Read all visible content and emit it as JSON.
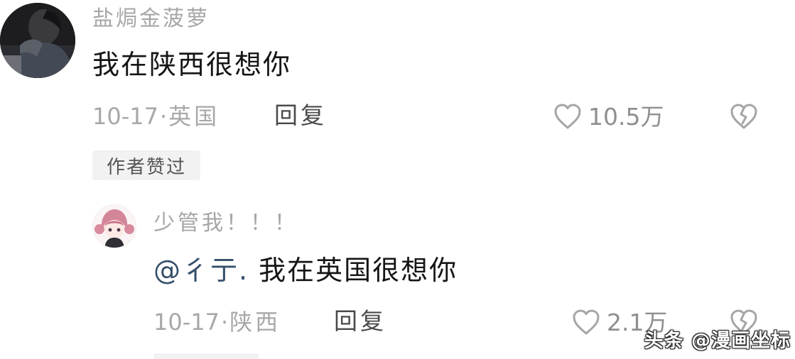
{
  "comment": {
    "username": "盐焗金菠萝",
    "text": "我在陕西很想你",
    "date": "10-17",
    "location": "英国",
    "reply_label": "回复",
    "like_count": "10.5万",
    "author_liked_badge": "作者赞过"
  },
  "reply": {
    "username": "少管我！！！",
    "mention": "@彳亍.",
    "text": " 我在英国很想你",
    "date": "10-17",
    "location": "陕西",
    "reply_label": "回复",
    "like_count": "2.1万"
  },
  "watermark": "头条 @漫画坐标",
  "meta_separator": "·",
  "icons": {
    "like": "heart-outline-icon",
    "dislike": "broken-heart-icon"
  },
  "colors": {
    "username": "#a6a6a6",
    "mention": "#35506b",
    "meta": "#a8a8a8",
    "badge_bg": "#f2f2f2"
  }
}
